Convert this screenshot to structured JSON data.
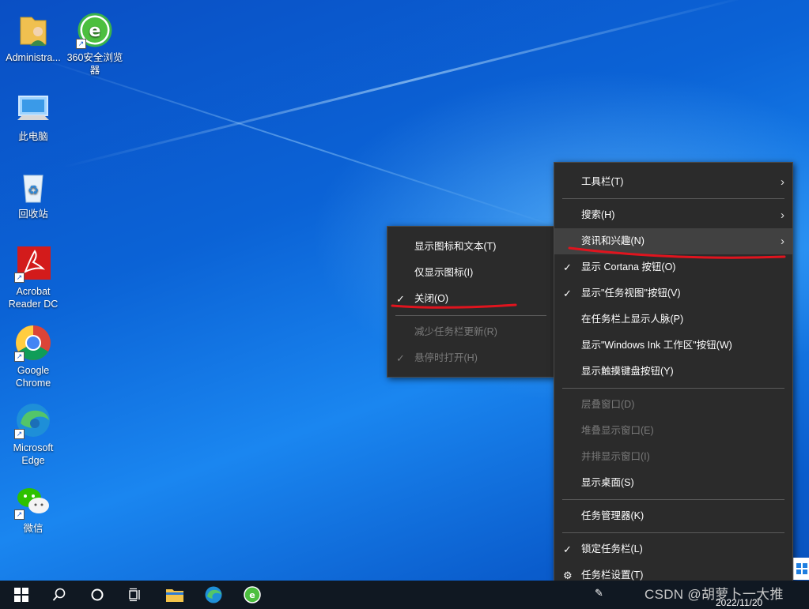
{
  "desktop_icons": [
    {
      "label": "Administra...",
      "icon": "user-folder-icon"
    },
    {
      "label": "360安全浏览器",
      "icon": "360-browser-icon"
    },
    {
      "label": "此电脑",
      "icon": "this-pc-icon"
    },
    {
      "label": "回收站",
      "icon": "recycle-bin-icon"
    },
    {
      "label": "Acrobat Reader DC",
      "icon": "acrobat-icon"
    },
    {
      "label": "Google Chrome",
      "icon": "chrome-icon"
    },
    {
      "label": "Microsoft Edge",
      "icon": "edge-icon"
    },
    {
      "label": "微信",
      "icon": "wechat-icon"
    }
  ],
  "submenu": {
    "items": [
      {
        "label": "显示图标和文本(T)",
        "checked": false,
        "disabled": false
      },
      {
        "label": "仅显示图标(I)",
        "checked": false,
        "disabled": false
      },
      {
        "label": "关闭(O)",
        "checked": true,
        "disabled": false
      },
      {
        "label": "减少任务栏更新(R)",
        "checked": false,
        "disabled": true
      },
      {
        "label": "悬停时打开(H)",
        "checked": true,
        "disabled": true
      }
    ]
  },
  "context_menu": {
    "items": [
      {
        "label": "工具栏(T)",
        "submenu": true
      },
      {
        "label": "搜索(H)",
        "submenu": true
      },
      {
        "label": "资讯和兴趣(N)",
        "submenu": true,
        "highlighted": true
      },
      {
        "label": "显示 Cortana 按钮(O)",
        "checked": true
      },
      {
        "label": "显示\"任务视图\"按钮(V)",
        "checked": true
      },
      {
        "label": "在任务栏上显示人脉(P)"
      },
      {
        "label": "显示\"Windows Ink 工作区\"按钮(W)"
      },
      {
        "label": "显示触摸键盘按钮(Y)"
      },
      {
        "label": "层叠窗口(D)",
        "disabled": true
      },
      {
        "label": "堆叠显示窗口(E)",
        "disabled": true
      },
      {
        "label": "并排显示窗口(I)",
        "disabled": true
      },
      {
        "label": "显示桌面(S)"
      },
      {
        "label": "任务管理器(K)"
      },
      {
        "label": "锁定任务栏(L)",
        "checked": true
      },
      {
        "label": "任务栏设置(T)",
        "icon": "gear-icon"
      }
    ]
  },
  "taskbar": {
    "items": [
      "start-icon",
      "search-icon",
      "cortana-icon",
      "task-view-icon",
      "file-explorer-icon",
      "edge-icon",
      "360-browser-icon"
    ],
    "date": "2022/11/20"
  },
  "watermark": "CSDN @胡萝卜一大推",
  "colors": {
    "menu_bg": "#2b2b2b",
    "menu_highlight": "#414141",
    "annotation_red": "#e0141e",
    "taskbar_bg": "#101822"
  }
}
